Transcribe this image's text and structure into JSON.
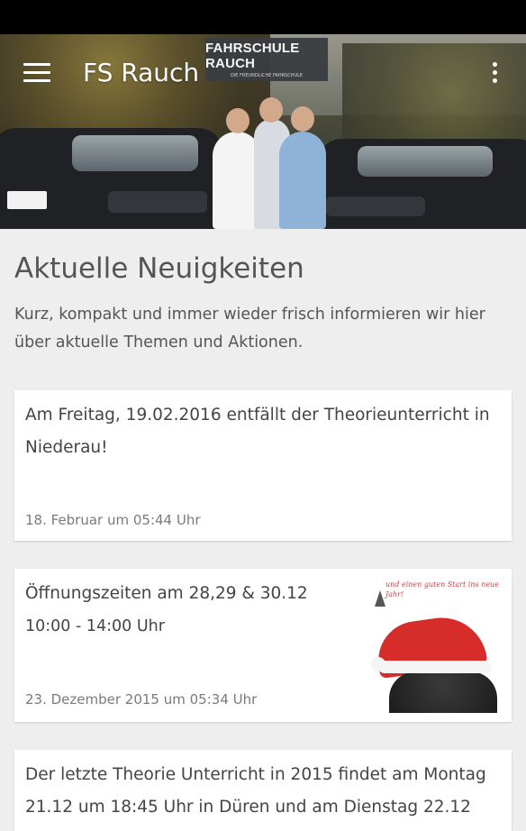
{
  "app": {
    "title": "FS Rauch"
  },
  "hero": {
    "logo_title": "FAHRSCHULE RAUCH",
    "logo_sub": "DIE FREUNDLICHE FAHRSCHULE"
  },
  "main": {
    "heading": "Aktuelle Neuigkeiten",
    "intro": "Kurz, kompakt und immer wieder frisch informieren wir hier über aktuelle Themen und Aktionen."
  },
  "posts": [
    {
      "title": "Am Freitag, 19.02.2016 entfällt der Theorieunterricht in Niederau!",
      "date": "18. Februar um 05:44 Uhr"
    },
    {
      "title": "Öffnungszeiten am 28,29 & 30.12",
      "subtitle": "10:00 - 14:00 Uhr",
      "date": "23. Dezember 2015 um 05:34 Uhr",
      "thumb_caption": "und einen guten Start ins neue Jahr!"
    },
    {
      "title": "Der letzte Theorie Unterricht in 2015 findet am Montag 21.12 um 18:45 Uhr in Düren und am Dienstag 22.12"
    }
  ],
  "icons": {
    "menu": "hamburger-menu-icon",
    "overflow": "more-vertical-icon"
  },
  "colors": {
    "background": "#eeeeee",
    "card": "#ffffff",
    "text": "#555555"
  }
}
